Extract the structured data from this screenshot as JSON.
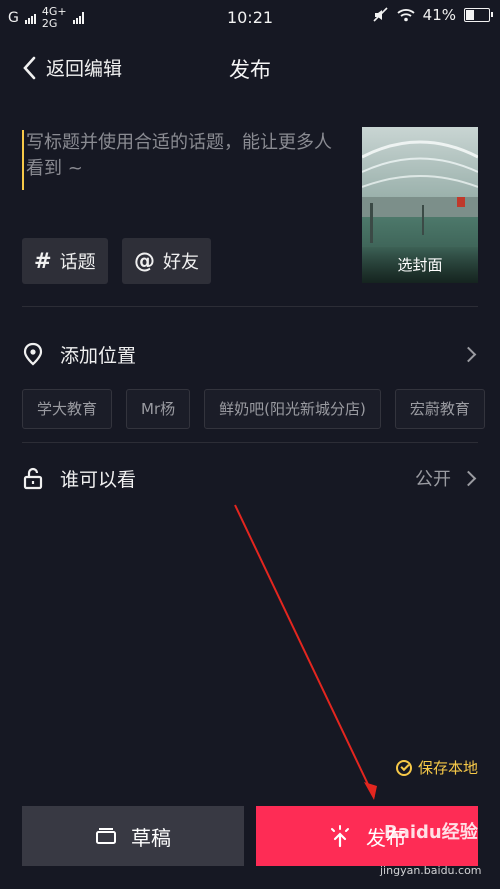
{
  "status_bar": {
    "carrier": "G",
    "network_top": "4G+",
    "network_bottom": "2G",
    "time": "10:21",
    "battery": "41%",
    "battery_level": 0.41
  },
  "nav": {
    "back_label": "返回编辑",
    "title": "发布"
  },
  "caption": {
    "placeholder": "写标题并使用合适的话题，能让更多人看到 ~",
    "value": ""
  },
  "cover": {
    "label": "选封面"
  },
  "tags": {
    "topic_symbol": "#",
    "topic_label": "话题",
    "friend_symbol": "@",
    "friend_label": "好友"
  },
  "location": {
    "label": "添加位置",
    "suggestions": [
      "学大教育",
      "Mr杨",
      "鲜奶吧(阳光新城分店)",
      "宏蔚教育"
    ]
  },
  "visibility": {
    "label": "谁可以看",
    "value": "公开"
  },
  "save_local": {
    "label": "保存本地"
  },
  "actions": {
    "draft_label": "草稿",
    "publish_label": "发布"
  },
  "colors": {
    "background": "#161823",
    "accent": "#fe2c55",
    "highlight": "#f7c948"
  },
  "watermark": {
    "brand": "Baidu经验",
    "url": "jingyan.baidu.com"
  }
}
